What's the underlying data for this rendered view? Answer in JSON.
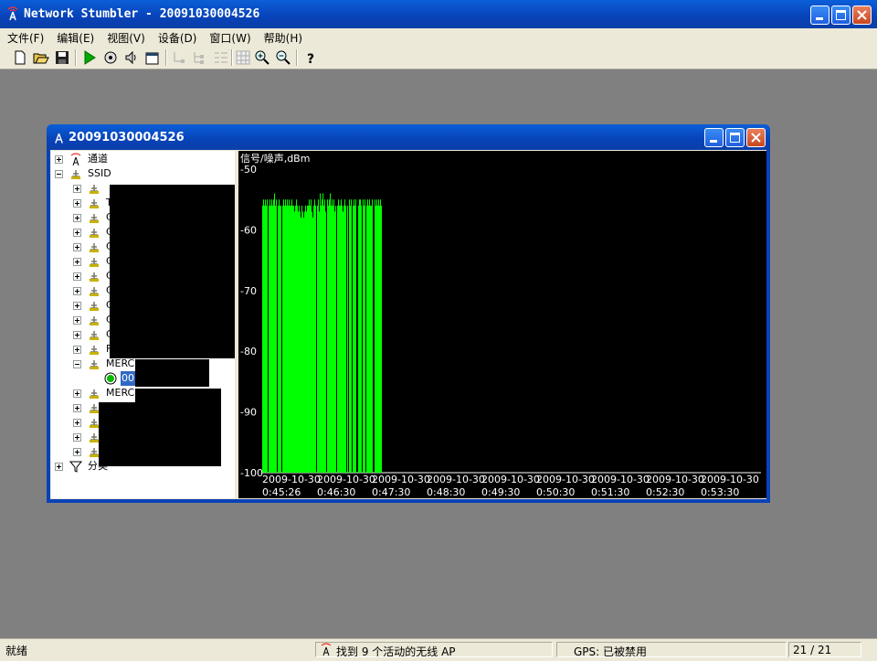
{
  "app": {
    "title": "Network Stumbler - 20091030004526"
  },
  "menu": [
    "文件(F)",
    "编辑(E)",
    "视图(V)",
    "设备(D)",
    "窗口(W)",
    "帮助(H)"
  ],
  "toolbar_icons": [
    "new-icon",
    "open-icon",
    "save-icon",
    "play-icon",
    "scan-settings-icon",
    "sound-icon",
    "properties-icon",
    "tree-icon-1",
    "tree-icon-2",
    "tree-icon-3",
    "grid-icon",
    "zoom-in-icon",
    "zoom-out-icon",
    "help-icon"
  ],
  "child": {
    "title": "20091030004526"
  },
  "tree": {
    "channels": "通道",
    "ssid": "SSID",
    "ssid_items": [
      {
        "label": ""
      },
      {
        "label": "T"
      },
      {
        "label": "C"
      },
      {
        "label": "C"
      },
      {
        "label": "C"
      },
      {
        "label": "C"
      },
      {
        "label": "C"
      },
      {
        "label": "C"
      },
      {
        "label": "C"
      },
      {
        "label": "C"
      },
      {
        "label": "C"
      },
      {
        "label": "F"
      }
    ],
    "expanded": {
      "label": "MERC",
      "child": "00"
    },
    "after_items": [
      {
        "label": "MERC"
      },
      {
        "label": ""
      },
      {
        "label": ""
      },
      {
        "label": ""
      },
      {
        "label": ""
      }
    ],
    "filters": "分类"
  },
  "chart_data": {
    "type": "bar",
    "ylabel": "信号/噪声,dBm",
    "ylim": [
      -100,
      -50
    ],
    "yticks": [
      -50,
      -60,
      -70,
      -80,
      -90,
      -100
    ],
    "xticks": [
      {
        "date": "2009-10-30",
        "time": "0:45:26"
      },
      {
        "date": "2009-10-30",
        "time": "0:46:30"
      },
      {
        "date": "2009-10-30",
        "time": "0:47:30"
      },
      {
        "date": "2009-10-30",
        "time": "0:48:30"
      },
      {
        "date": "2009-10-30",
        "time": "0:49:30"
      },
      {
        "date": "2009-10-30",
        "time": "0:50:30"
      },
      {
        "date": "2009-10-30",
        "time": "0:51:30"
      },
      {
        "date": "2009-10-30",
        "time": "0:52:30"
      },
      {
        "date": "2009-10-30",
        "time": "0:53:30"
      }
    ],
    "bar_color": "#00ff00",
    "background": "#000000",
    "samples_dbm": [
      -56,
      -55,
      -56,
      -55,
      -56,
      -55,
      -100,
      -56,
      -55,
      -56,
      -55,
      -56,
      -55,
      -54,
      -56,
      -55,
      -100,
      -56,
      -55,
      -56,
      -56,
      -100,
      -56,
      -55,
      -56,
      -55,
      -56,
      -55,
      -56,
      -55,
      -56,
      -56,
      -55,
      -56,
      -56,
      -57,
      -56,
      -55,
      -56,
      -57,
      -56,
      -57,
      -58,
      -56,
      -57,
      -58,
      -57,
      -56,
      -57,
      -56,
      -56,
      -55,
      -56,
      -55,
      -57,
      -58,
      -56,
      -55,
      -56,
      -100,
      -56,
      -55,
      -57,
      -54,
      -56,
      -55,
      -54,
      -56,
      -55,
      -57,
      -100,
      -55,
      -56,
      -55,
      -54,
      -56,
      -55,
      -56,
      -55,
      -57,
      -56,
      -100,
      -56,
      -55,
      -56,
      -56,
      -55,
      -56,
      -57,
      -56,
      -55,
      -56,
      -100,
      -56,
      -100,
      -55,
      -56,
      -55,
      -100,
      -56,
      -55,
      -56,
      -55,
      -100,
      -100,
      -56,
      -55,
      -55,
      -56,
      -100,
      -55,
      -56,
      -55,
      -100,
      -56,
      -55,
      -56,
      -55,
      -56,
      -56,
      -55,
      -100,
      -100,
      -55,
      -56,
      -55,
      -56,
      -55,
      -56,
      -55,
      -56
    ]
  },
  "status": {
    "ready": "就绪",
    "found": "找到 9 个活动的无线 AP",
    "gps": "GPS: 已被禁用",
    "count": "21 / 21"
  }
}
